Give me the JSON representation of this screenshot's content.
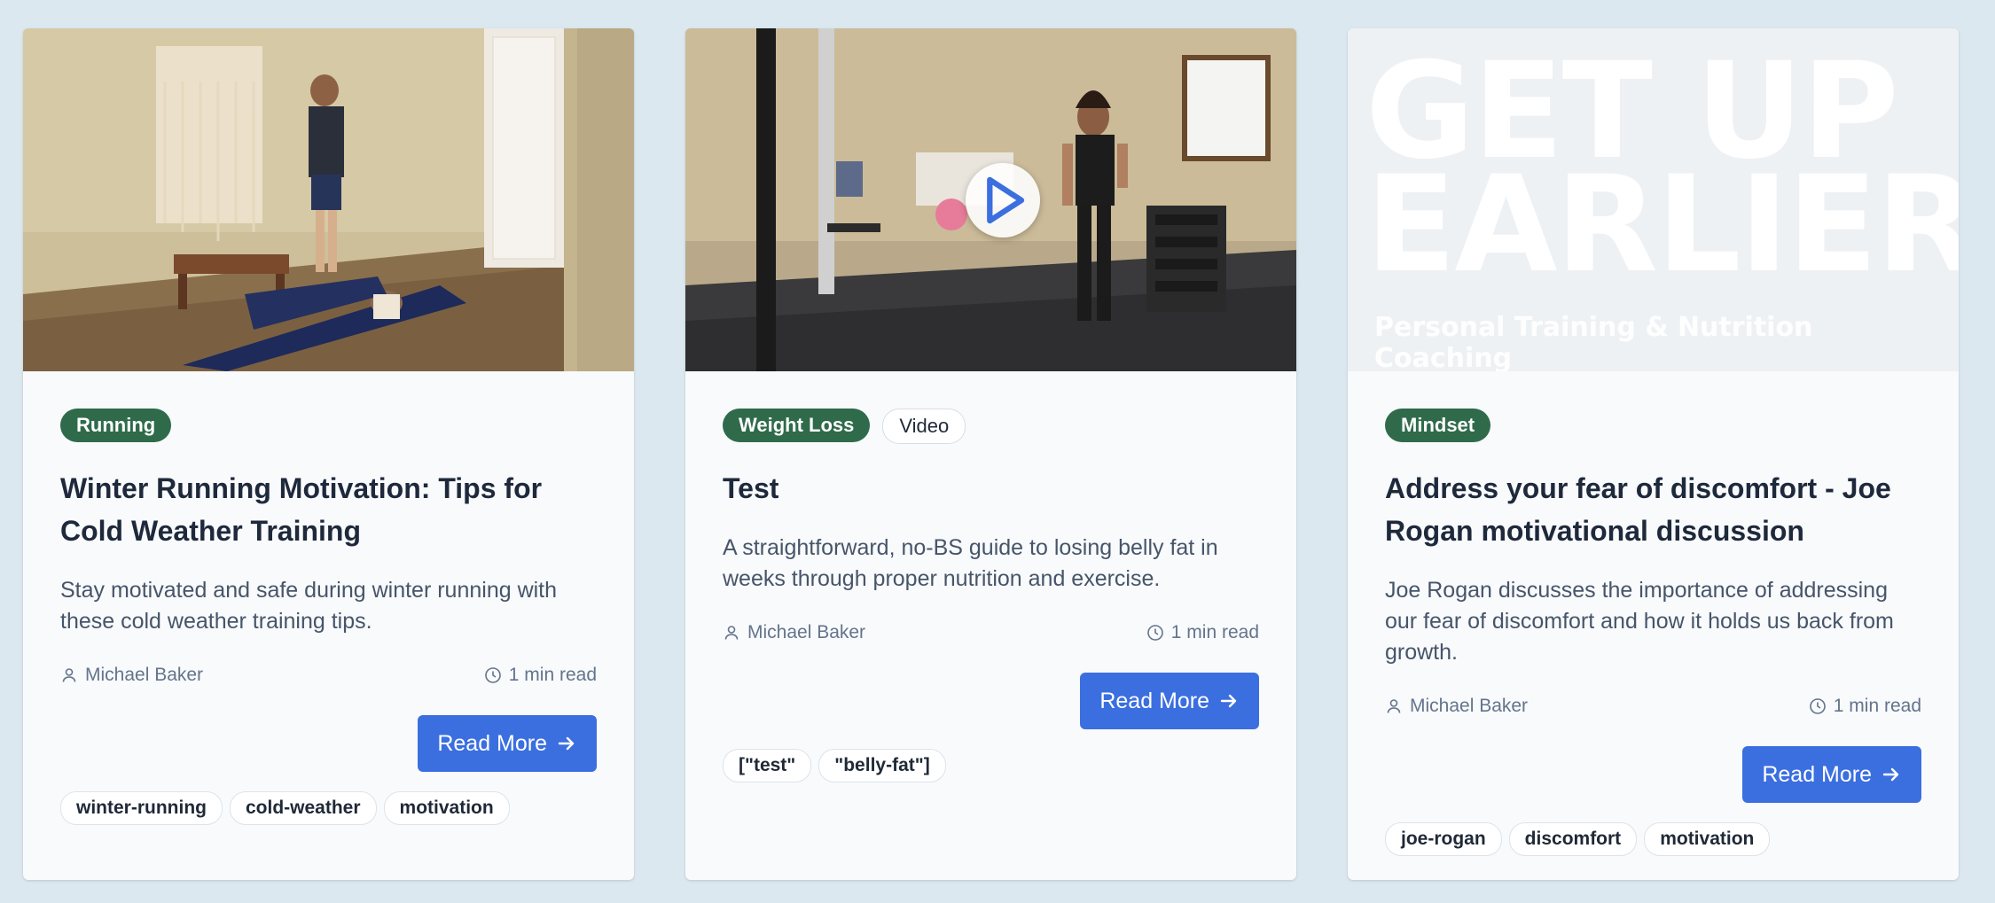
{
  "cards": [
    {
      "category": "Running",
      "title": "Winter Running Motivation: Tips for Cold Weather Training",
      "excerpt": "Stay motivated and safe during winter running with these cold weather training tips.",
      "author": "Michael Baker",
      "read_time": "1 min read",
      "read_more": "Read More",
      "tags": [
        "winter-running",
        "cold-weather",
        "motivation"
      ]
    },
    {
      "category": "Weight Loss",
      "type_badge": "Video",
      "title": "Test",
      "excerpt": "A straightforward, no-BS guide to losing belly fat in weeks through proper nutrition and exercise.",
      "author": "Michael Baker",
      "read_time": "1 min read",
      "read_more": "Read More",
      "tags": [
        "[\"test\"",
        "\"belly-fat\"]"
      ]
    },
    {
      "category": "Mindset",
      "title": "Address your fear of discomfort - Joe Rogan motivational discussion",
      "excerpt": "Joe Rogan discusses the importance of addressing our fear of discomfort and how it holds us back from growth.",
      "author": "Michael Baker",
      "read_time": "1 min read",
      "read_more": "Read More",
      "tags": [
        "joe-rogan",
        "discomfort",
        "motivation"
      ],
      "banner_line1": "GET UP",
      "banner_line2": "EARLIER",
      "banner_sub": "Personal Training & Nutrition Coaching"
    }
  ],
  "colors": {
    "page_bg": "#dce8ef",
    "category_badge": "#2f6b4b",
    "button": "#3b6fe0"
  },
  "icons": {
    "author": "user-icon",
    "time": "clock-icon",
    "arrow": "arrow-right-icon",
    "play": "play-icon"
  }
}
